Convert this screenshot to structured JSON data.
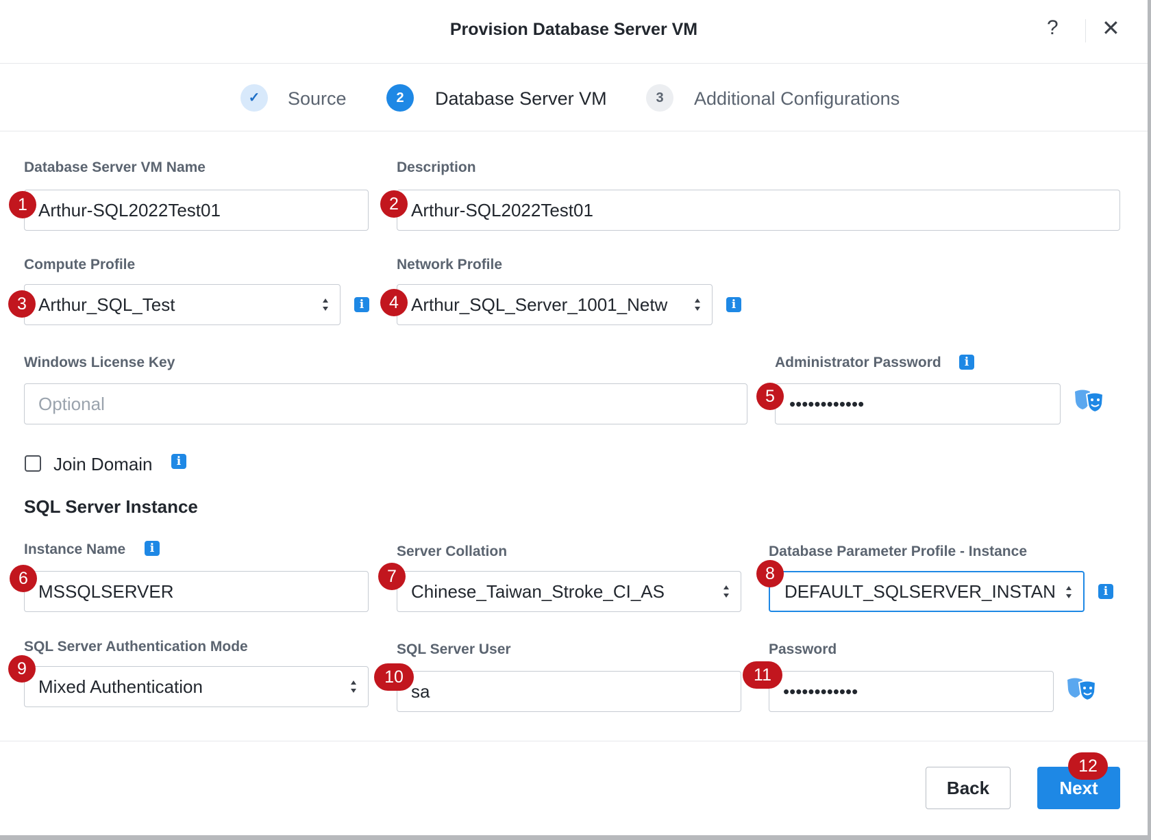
{
  "dialog": {
    "title": "Provision Database Server VM",
    "help": "?",
    "close": "✕"
  },
  "steps": [
    {
      "marker": "✓",
      "label": "Source",
      "state": "done"
    },
    {
      "marker": "2",
      "label": "Database Server VM",
      "state": "active"
    },
    {
      "marker": "3",
      "label": "Additional Configurations",
      "state": "pending"
    }
  ],
  "form": {
    "vm_name": {
      "label": "Database Server VM Name",
      "value": "Arthur-SQL2022Test01"
    },
    "description": {
      "label": "Description",
      "value": "Arthur-SQL2022Test01"
    },
    "compute_profile": {
      "label": "Compute Profile",
      "value": "Arthur_SQL_Test"
    },
    "network_profile": {
      "label": "Network Profile",
      "value": "Arthur_SQL_Server_1001_Netw"
    },
    "license_key": {
      "label": "Windows License Key",
      "placeholder": "Optional",
      "value": ""
    },
    "admin_password": {
      "label": "Administrator Password",
      "value": "••••••••••••"
    },
    "join_domain": {
      "label": "Join Domain",
      "checked": false
    },
    "sql_section": {
      "title": "SQL Server Instance"
    },
    "instance_name": {
      "label": "Instance Name",
      "value": "MSSQLSERVER"
    },
    "server_collation": {
      "label": "Server Collation",
      "value": "Chinese_Taiwan_Stroke_CI_AS"
    },
    "param_profile": {
      "label": "Database Parameter Profile - Instance",
      "value": "DEFAULT_SQLSERVER_INSTAN"
    },
    "auth_mode": {
      "label": "SQL Server Authentication Mode",
      "value": "Mixed Authentication"
    },
    "sql_user": {
      "label": "SQL Server User",
      "value": "sa"
    },
    "sql_password": {
      "label": "Password",
      "value": "••••••••••••"
    }
  },
  "footer": {
    "back": "Back",
    "next": "Next"
  },
  "badges": [
    "1",
    "2",
    "3",
    "4",
    "5",
    "6",
    "7",
    "8",
    "9",
    "10",
    "11",
    "12"
  ],
  "colors": {
    "accent": "#1e88e5",
    "badge": "#c2161e",
    "step_done_bg": "#d8e9fb"
  }
}
